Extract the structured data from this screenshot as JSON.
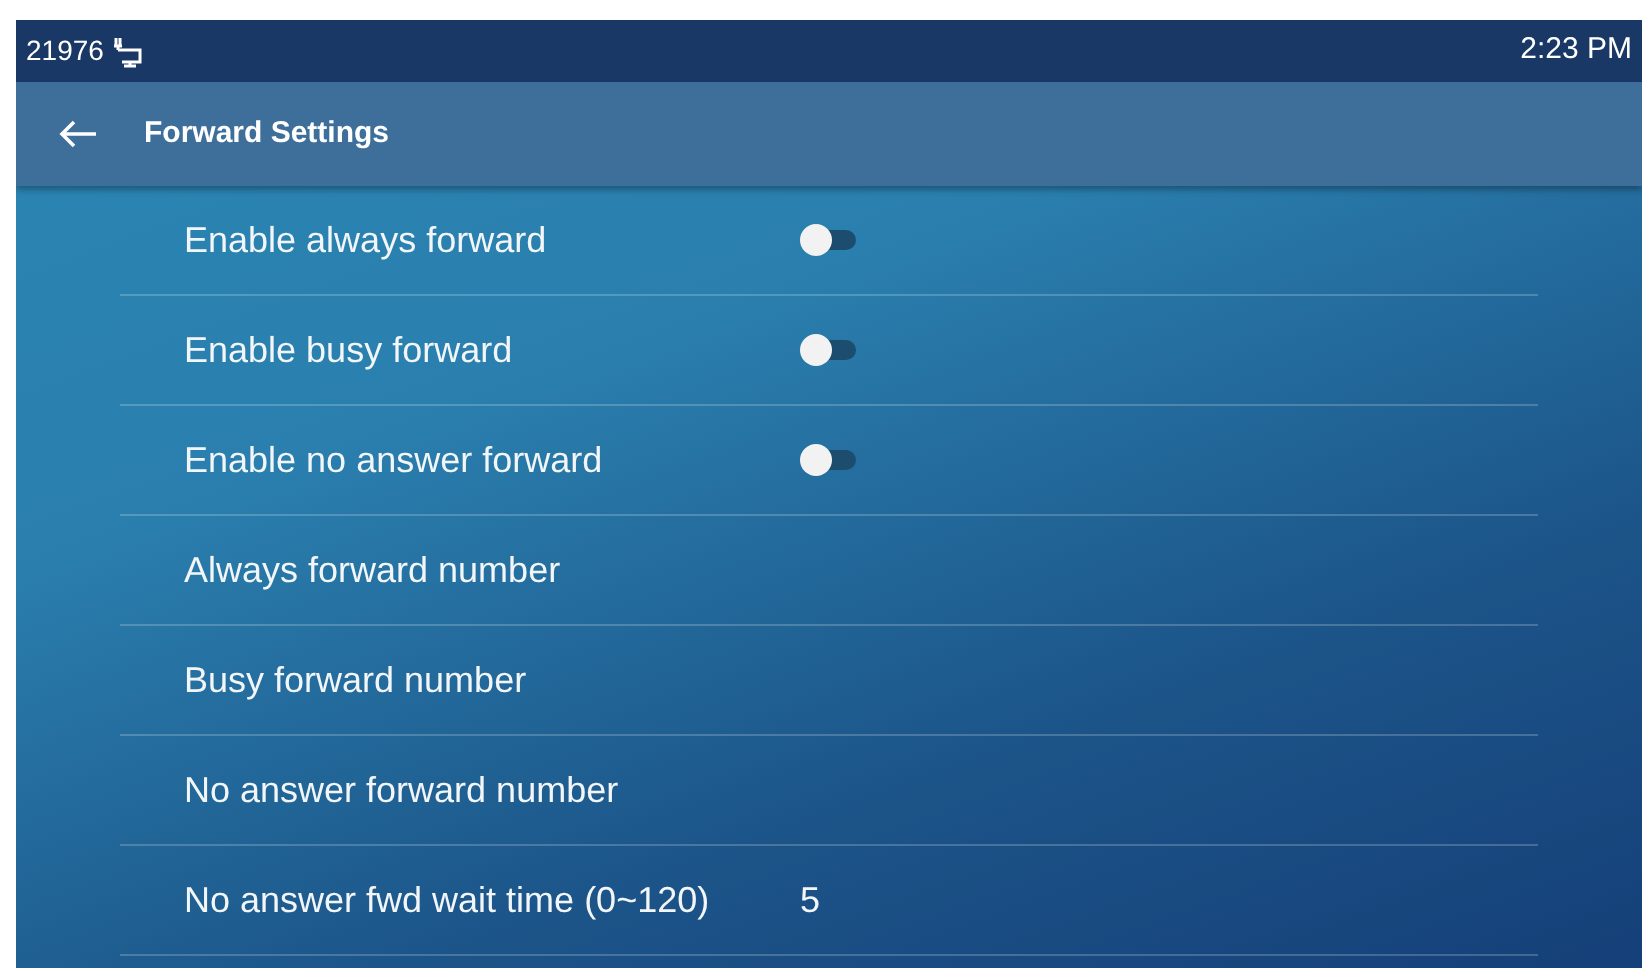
{
  "status_bar": {
    "extension": "21976",
    "time": "2:23 PM"
  },
  "title_bar": {
    "title": "Forward Settings"
  },
  "settings": [
    {
      "kind": "toggle",
      "label": "Enable always forward",
      "on": false
    },
    {
      "kind": "toggle",
      "label": "Enable busy forward",
      "on": false
    },
    {
      "kind": "toggle",
      "label": "Enable no answer forward",
      "on": false
    },
    {
      "kind": "field",
      "label": "Always forward number"
    },
    {
      "kind": "field",
      "label": "Busy forward number"
    },
    {
      "kind": "field",
      "label": "No answer forward number"
    },
    {
      "kind": "field",
      "label": "No answer fwd wait time (0~120)",
      "value": "5"
    }
  ]
}
